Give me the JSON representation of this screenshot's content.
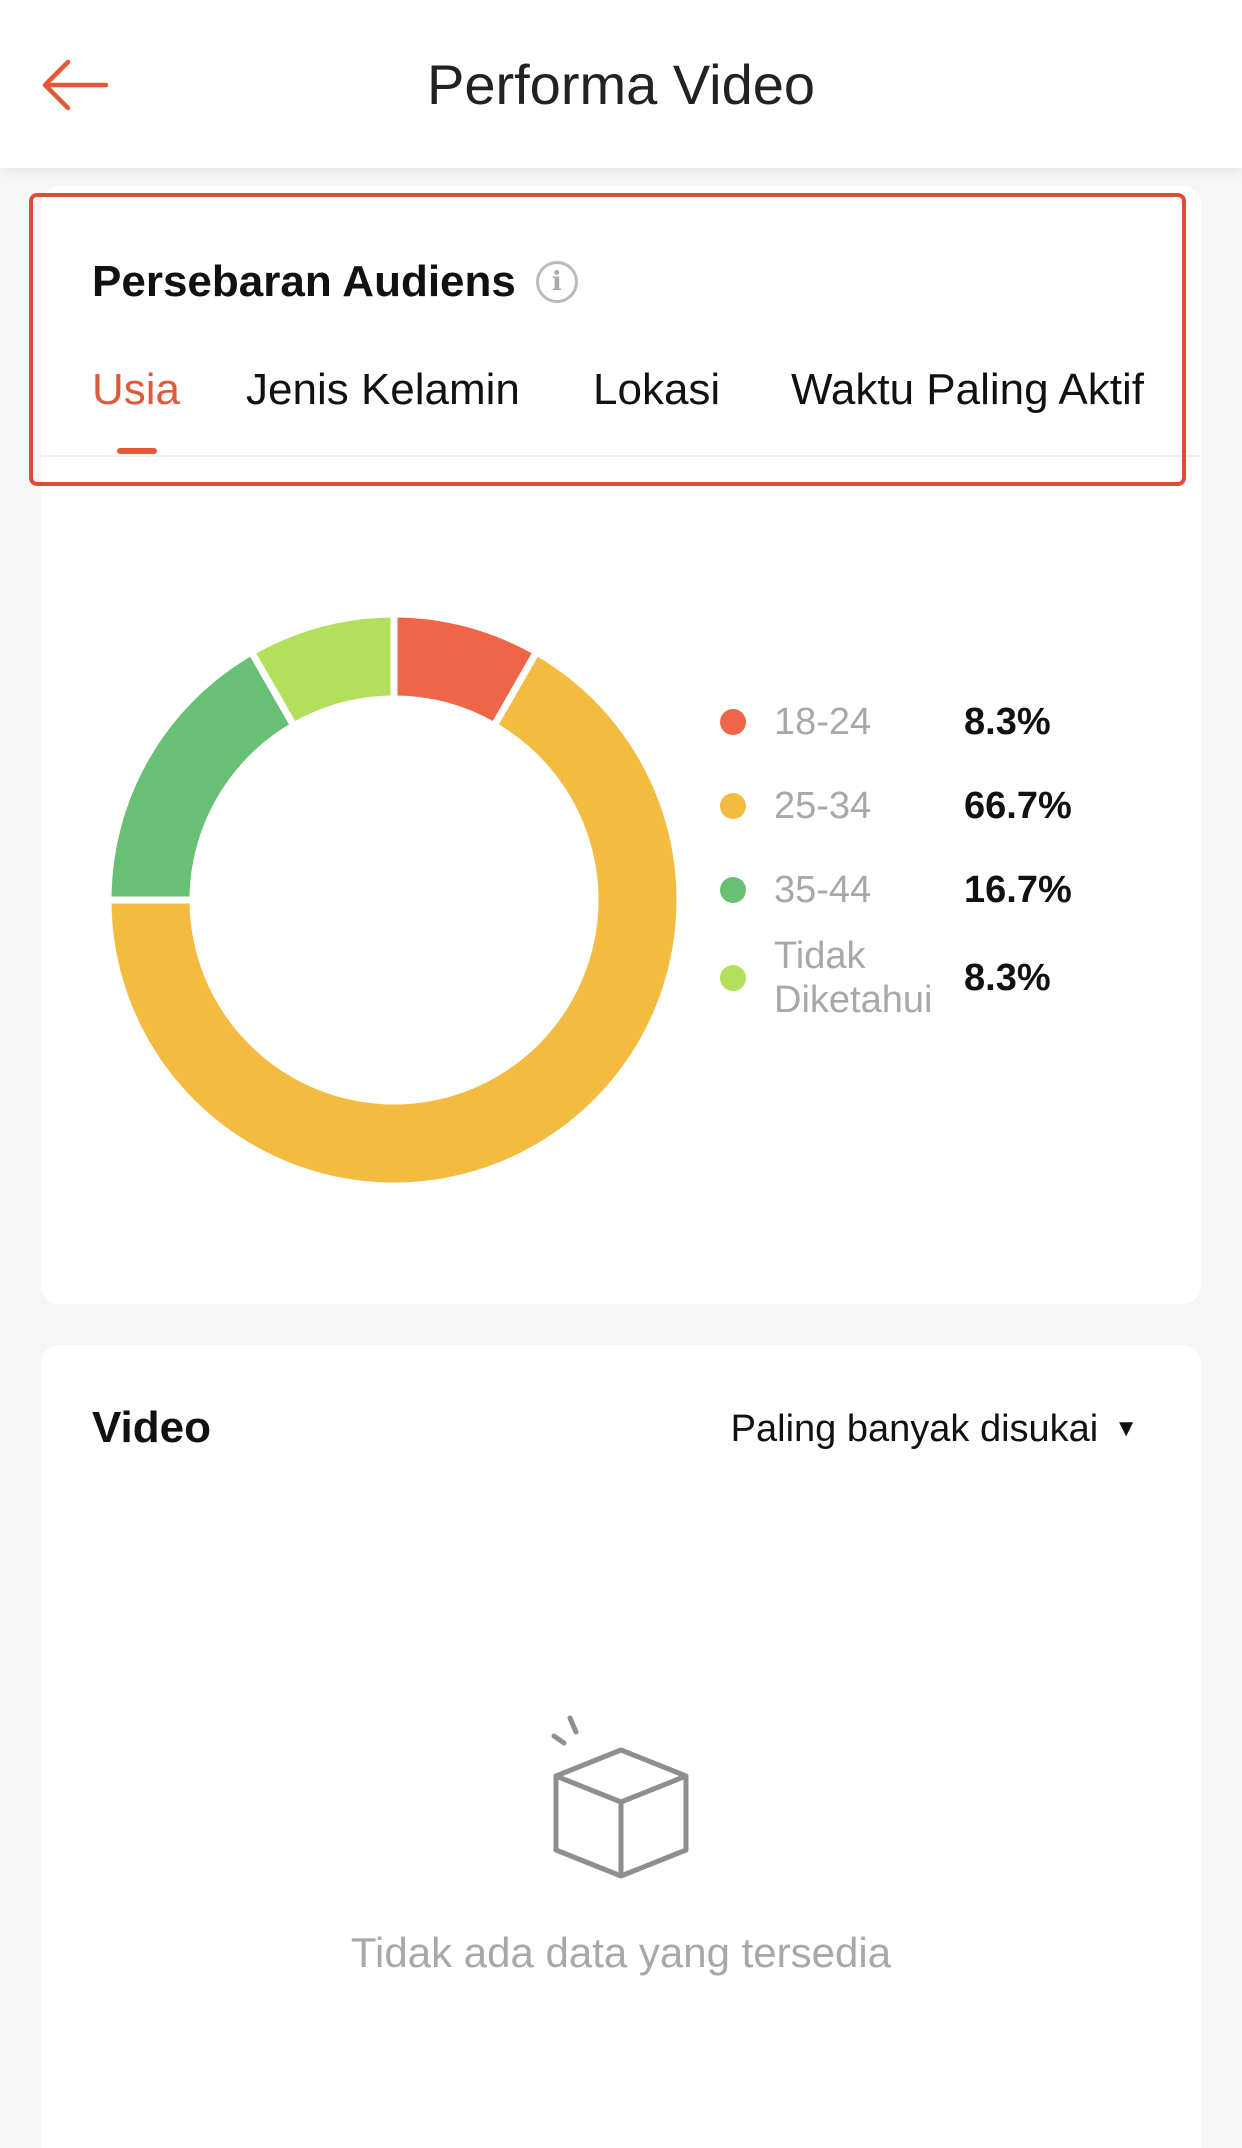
{
  "header": {
    "title": "Performa Video",
    "back_icon": "arrow-left-icon",
    "accent_color": "#e05a3a"
  },
  "audience": {
    "title": "Persebaran Audiens",
    "info_icon": "info-icon",
    "tabs": [
      {
        "label": "Usia",
        "active": true
      },
      {
        "label": "Jenis Kelamin",
        "active": false
      },
      {
        "label": "Lokasi",
        "active": false
      },
      {
        "label": "Waktu Paling Aktif",
        "active": false
      }
    ]
  },
  "chart_data": {
    "type": "pie",
    "categories": [
      "18-24",
      "25-34",
      "35-44",
      "Tidak Diketahui"
    ],
    "values": [
      8.3,
      66.7,
      16.7,
      8.3
    ],
    "value_labels": [
      "8.3%",
      "66.7%",
      "16.7%",
      "8.3%"
    ],
    "colors": [
      "#ef6548",
      "#f3bb40",
      "#67c073",
      "#b2e05a"
    ],
    "donut": true,
    "legend_position": "right"
  },
  "video": {
    "title": "Video",
    "sort_label": "Paling banyak disukai",
    "sort_icon": "caret-down-icon",
    "empty_icon": "empty-box-icon",
    "empty_text": "Tidak ada data yang tersedia"
  }
}
